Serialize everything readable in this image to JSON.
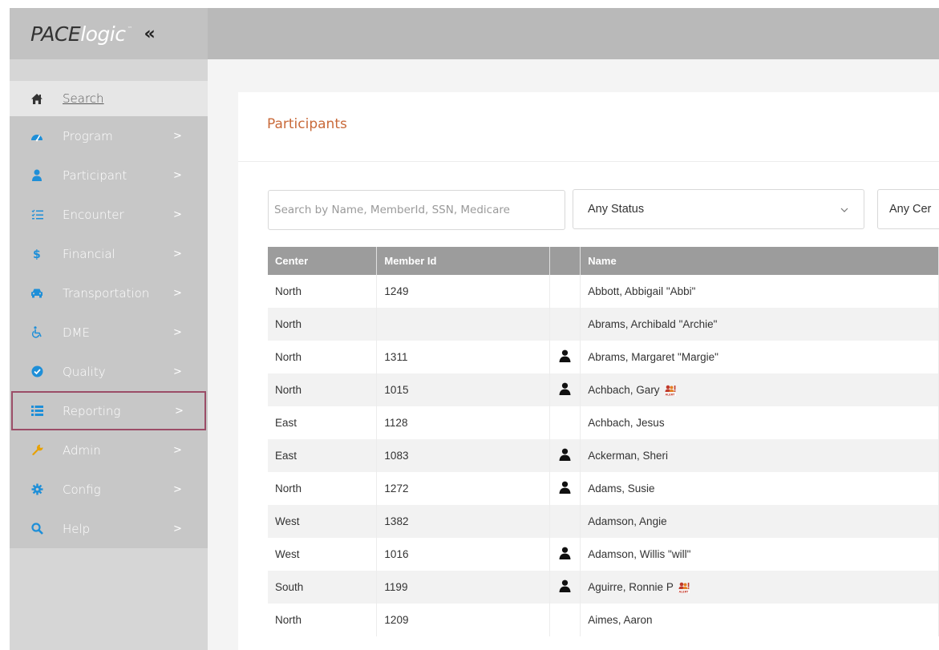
{
  "header": {
    "brand_main": "PACE",
    "brand_sub": "logic",
    "brand_tm": "™",
    "collapse_label": "«"
  },
  "sidebar": {
    "items": [
      {
        "label": "Search",
        "icon": "home-icon"
      },
      {
        "label": "Program",
        "icon": "dashboard-icon"
      },
      {
        "label": "Participant",
        "icon": "user-icon"
      },
      {
        "label": "Encounter",
        "icon": "list-check-icon"
      },
      {
        "label": "Financial",
        "icon": "dollar-icon"
      },
      {
        "label": "Transportation",
        "icon": "car-icon"
      },
      {
        "label": "DME",
        "icon": "wheelchair-icon"
      },
      {
        "label": "Quality",
        "icon": "check-circle-icon"
      },
      {
        "label": "Reporting",
        "icon": "list-icon"
      },
      {
        "label": "Admin",
        "icon": "wrench-icon"
      },
      {
        "label": "Config",
        "icon": "gear-icon"
      },
      {
        "label": "Help",
        "icon": "magnifier-icon"
      }
    ],
    "chevron": ">"
  },
  "page": {
    "title": "Participants",
    "search_placeholder": "Search by Name, MemberId, SSN, Medicare",
    "status_select": "Any Status",
    "center_select": "Any Cer"
  },
  "table": {
    "columns": [
      "Center",
      "Member Id",
      "",
      "Name"
    ],
    "rows": [
      {
        "center": "North",
        "member_id": "1249",
        "person_icon": false,
        "name": "Abbott, Abbigail \"Abbi\"",
        "alert": false
      },
      {
        "center": "North",
        "member_id": "",
        "person_icon": false,
        "name": "Abrams, Archibald \"Archie\"",
        "alert": false
      },
      {
        "center": "North",
        "member_id": "1311",
        "person_icon": true,
        "name": "Abrams, Margaret \"Margie\"",
        "alert": false
      },
      {
        "center": "North",
        "member_id": "1015",
        "person_icon": true,
        "name": "Achbach, Gary",
        "alert": true
      },
      {
        "center": "East",
        "member_id": "1128",
        "person_icon": false,
        "name": "Achbach, Jesus",
        "alert": false
      },
      {
        "center": "East",
        "member_id": "1083",
        "person_icon": true,
        "name": "Ackerman, Sheri",
        "alert": false
      },
      {
        "center": "North",
        "member_id": "1272",
        "person_icon": true,
        "name": "Adams, Susie",
        "alert": false
      },
      {
        "center": "West",
        "member_id": "1382",
        "person_icon": false,
        "name": "Adamson, Angie",
        "alert": false
      },
      {
        "center": "West",
        "member_id": "1016",
        "person_icon": true,
        "name": "Adamson, Willis \"will\"",
        "alert": false
      },
      {
        "center": "South",
        "member_id": "1199",
        "person_icon": true,
        "name": "Aguirre, Ronnie P",
        "alert": true
      },
      {
        "center": "North",
        "member_id": "1209",
        "person_icon": false,
        "name": "Aimes, Aaron",
        "alert": false
      }
    ]
  },
  "colors": {
    "title": "#c96a3a",
    "header_bar": "#b9b9b9",
    "sidebar": "#c7c7c7",
    "table_header": "#9c9c9c",
    "highlight_outline": "#9b4d67",
    "icon_blue": "#1e8fd8",
    "icon_yellow": "#e8a100"
  }
}
